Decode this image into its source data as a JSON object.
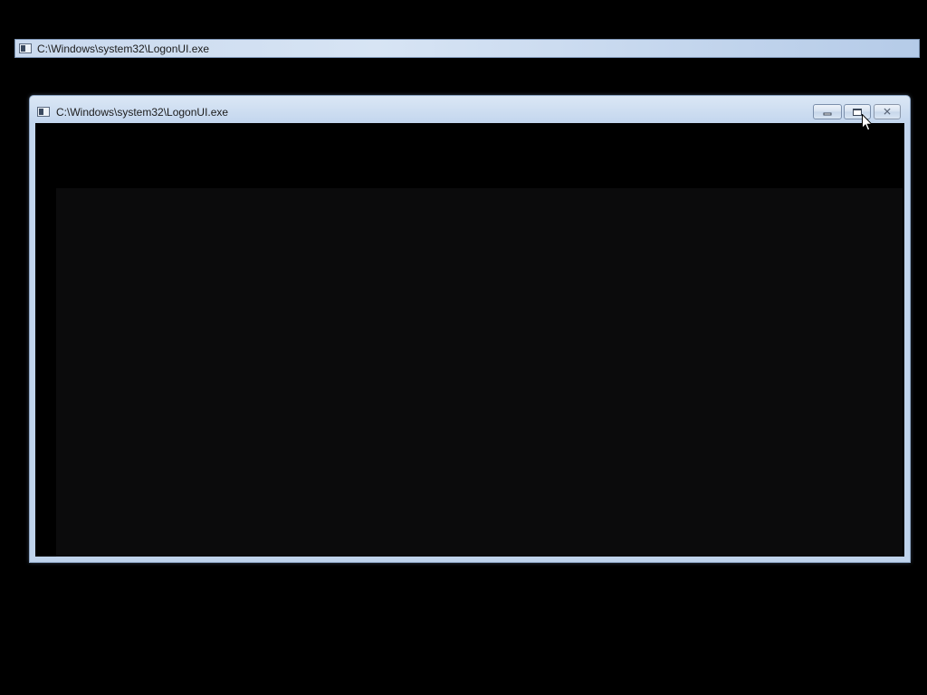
{
  "background_window": {
    "title": "C:\\Windows\\system32\\LogonUI.exe",
    "icon": "console-window-icon"
  },
  "window": {
    "title": "C:\\Windows\\system32\\LogonUI.exe",
    "icon": "console-window-icon",
    "buttons": {
      "minimize": "minimize-icon",
      "maximize": "maximize-icon",
      "close": "close-icon"
    }
  },
  "colors": {
    "desktop": "#000000",
    "frame": "#bfd3ec",
    "client": "#000000",
    "panel": "#0b0b0c"
  },
  "cursor": "arrow-pointer-icon"
}
